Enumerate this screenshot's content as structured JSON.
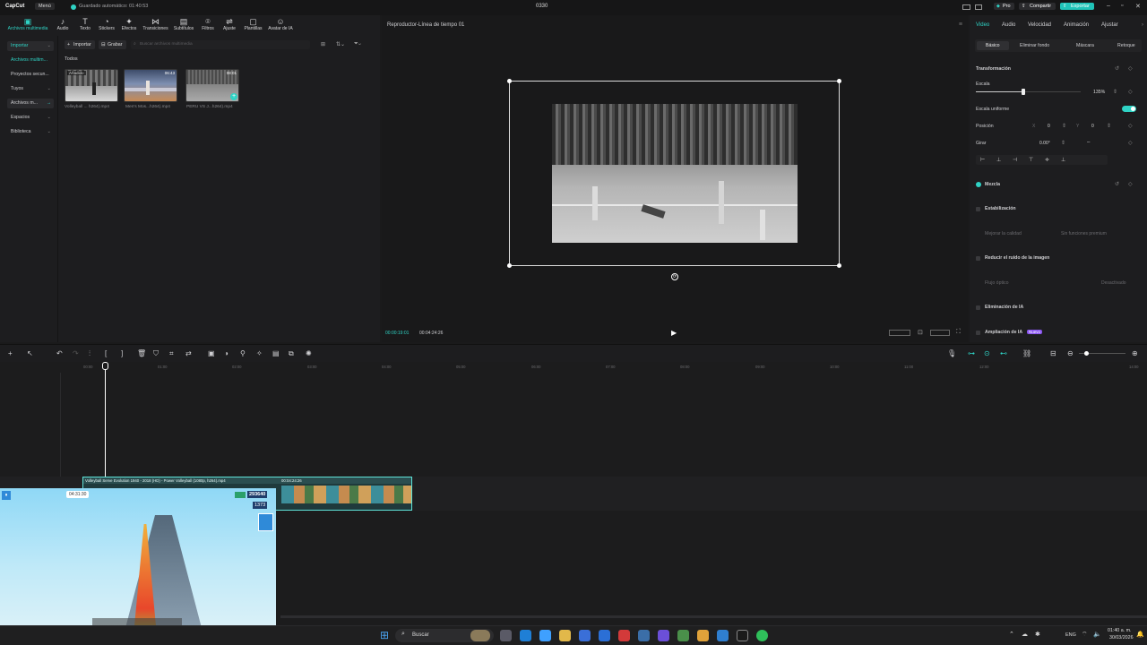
{
  "titlebar": {
    "logo": "CapCut",
    "menu": "Menú",
    "autosave": "Guardado automático: 01:40:53",
    "project": "0330",
    "pro": "Pro",
    "share": "Compartir",
    "export": "Exportar"
  },
  "toolbar": {
    "items": [
      {
        "label": "Archivos multimedia",
        "icon": "media-icon"
      },
      {
        "label": "Audio",
        "icon": "audio-icon"
      },
      {
        "label": "Texto",
        "icon": "text-icon"
      },
      {
        "label": "Stickers",
        "icon": "sticker-icon"
      },
      {
        "label": "Efectos",
        "icon": "effects-icon"
      },
      {
        "label": "Transiciones",
        "icon": "transitions-icon"
      },
      {
        "label": "Subtítulos",
        "icon": "subtitles-icon"
      },
      {
        "label": "Filtros",
        "icon": "filters-icon"
      },
      {
        "label": "Ajuste",
        "icon": "adjust-icon"
      },
      {
        "label": "Plantillas",
        "icon": "templates-icon"
      },
      {
        "label": "Avatar de IA",
        "icon": "ai-avatar-icon"
      }
    ]
  },
  "leftnav": {
    "items": [
      "Importar",
      "Archivos multim...",
      "Proyectos secun...",
      "Tuyos",
      "Archivos m...",
      "Espacios",
      "Biblioteca"
    ]
  },
  "media": {
    "import": "Importar",
    "record": "Grabar",
    "search_placeholder": "Buscar archivos multimedia",
    "section": "Todos",
    "clips": [
      {
        "name": "Volleyball ... h264).mp4",
        "badge": "Añadido",
        "duration": ""
      },
      {
        "name": "Men's Mos...h264).mp4",
        "badge": "",
        "duration": "06:43"
      },
      {
        "name": "PERU VS J...h264).mp4",
        "badge": "",
        "duration": "08:01"
      }
    ]
  },
  "player": {
    "title": "Reproductor-Línea de tiempo 01",
    "current_time": "00:00:19:01",
    "total_time": "00:04:24:26"
  },
  "props": {
    "tabs": [
      "Video",
      "Audio",
      "Velocidad",
      "Animación",
      "Ajustar"
    ],
    "subtabs": [
      "Básico",
      "Eliminar fondo",
      "Máscara",
      "Retoque"
    ],
    "transform": "Transformación",
    "scale": "Escala",
    "scale_value": "135%",
    "scale_level": 0.45,
    "uniform_scale": "Escala uniforme",
    "position": "Posición",
    "pos_x_label": "X",
    "pos_x": "0",
    "pos_y_label": "Y",
    "pos_y": "0",
    "rotate": "Girar",
    "rotate_value": "0.00°",
    "blend": "Mezcla",
    "stabilize": "Estabilización",
    "improve_quality": "Mejorar la calidad",
    "improve_hint": "Sin funciones premium",
    "denoise": "Reducir el ruido de la imagen",
    "optical_flow": "Flujo óptico",
    "optical_flow_hint": "Desactivado",
    "ai_removal": "Eliminación de IA",
    "ai_upscale": "Ampliación de IA",
    "new_badge": "Nuevo"
  },
  "timeline": {
    "ruler": [
      "00:00",
      "01:00",
      "02:00",
      "03:00",
      "04:00",
      "05:00",
      "06:00",
      "07:00",
      "08:00",
      "09:00",
      "10:00",
      "11:00",
      "12:00",
      "14:00"
    ],
    "clip_title": "Volleyball Serve Evolution 1940 - 2018 (HD) - Power Volleyball (1080p, h264).mp4",
    "clip_duration": "00:04:24:26",
    "overlay_time": "04:31:30",
    "overlay_score": "293640",
    "overlay_coins": "1373"
  },
  "taskbar": {
    "search": "Buscar",
    "lang": "ENG",
    "time": "01:40 a. m.",
    "date": "30/03/2026"
  },
  "colors": {
    "accent": "#2fd3c5",
    "export": "#20c3b8",
    "pro": "#2b2b2e",
    "badge": "#8a55f0"
  }
}
